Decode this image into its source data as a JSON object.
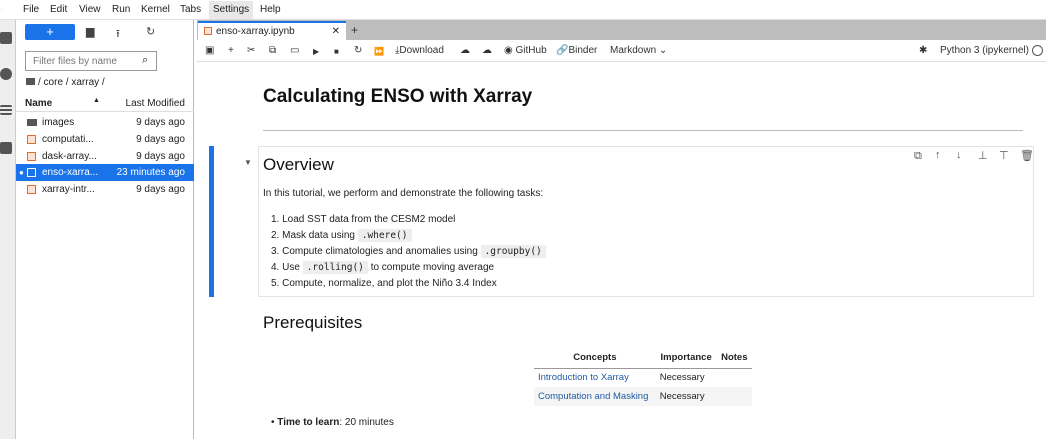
{
  "menu": [
    "File",
    "Edit",
    "View",
    "Run",
    "Kernel",
    "Tabs",
    "Settings",
    "Help"
  ],
  "filebrowser": {
    "new_label": "+",
    "filter_placeholder": "Filter files by name",
    "breadcrumb": "/ core / xarray /",
    "col_name": "Name",
    "col_modified": "Last Modified",
    "files": [
      {
        "name": "images",
        "modified": "9 days ago",
        "type": "folder"
      },
      {
        "name": "computati...",
        "modified": "9 days ago",
        "type": "notebook"
      },
      {
        "name": "dask-array...",
        "modified": "9 days ago",
        "type": "notebook"
      },
      {
        "name": "enso-xarra...",
        "modified": "23 minutes ago",
        "type": "notebook",
        "selected": true
      },
      {
        "name": "xarray-intr...",
        "modified": "9 days ago",
        "type": "notebook"
      }
    ]
  },
  "tab": {
    "title": "enso-xarray.ipynb"
  },
  "toolbar": {
    "download": "Download",
    "github": "GitHub",
    "binder": "Binder",
    "cell_type": "Markdown",
    "kernel": "Python 3 (ipykernel)"
  },
  "notebook": {
    "title": "Calculating ENSO with Xarray",
    "overview": "Overview",
    "intro": "In this tutorial, we perform and demonstrate the following tasks:",
    "tasks": [
      {
        "n": "1.",
        "a": "Load SST data from the CESM2 model"
      },
      {
        "n": "2.",
        "a": "Mask data using",
        "code": ".where()"
      },
      {
        "n": "3.",
        "a": "Compute climatologies and anomalies using",
        "code": ".groupby()"
      },
      {
        "n": "4.",
        "a": "Use",
        "code": ".rolling()",
        "b": "to compute moving average"
      },
      {
        "n": "5.",
        "a": "Compute, normalize, and plot the Niño 3.4 Index"
      }
    ],
    "prereq": "Prerequisites",
    "table": {
      "headers": [
        "Concepts",
        "Importance",
        "Notes"
      ],
      "rows": [
        [
          "Introduction to Xarray",
          "Necessary",
          ""
        ],
        [
          "Computation and Masking",
          "Necessary",
          ""
        ]
      ]
    },
    "time_label": "Time to learn",
    "time_value": ": 20 minutes"
  }
}
